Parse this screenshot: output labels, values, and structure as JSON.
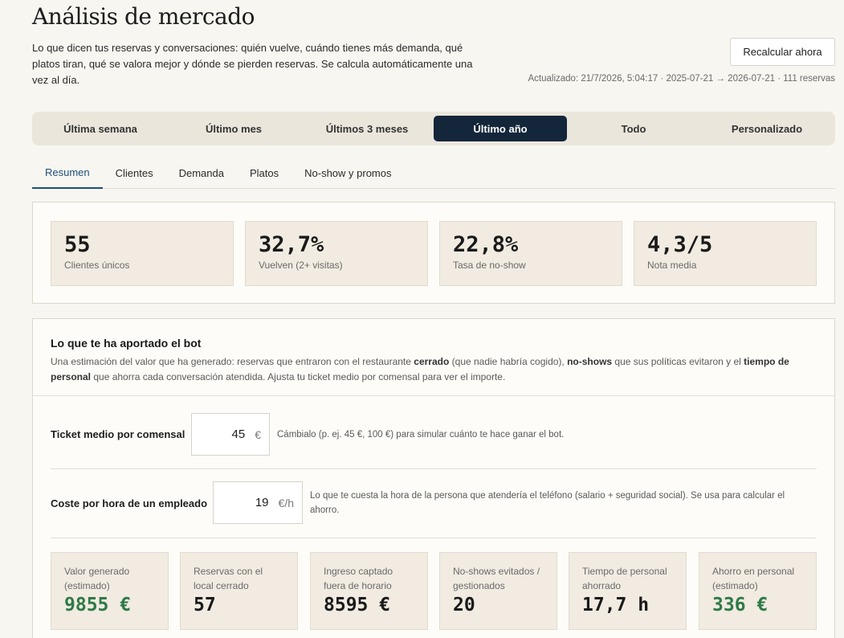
{
  "header": {
    "title": "Análisis de mercado",
    "description": "Lo que dicen tus reservas y conversaciones: quién vuelve, cuándo tienes más demanda, qué platos tiran, qué se valora mejor y dónde se pierden reservas. Se calcula automáticamente una vez al día.",
    "recalc_label": "Recalcular ahora",
    "updated": "Actualizado: 21/7/2026, 5:04:17 · 2025-07-21 → 2026-07-21 · 111 reservas"
  },
  "ranges": [
    "Última semana",
    "Último mes",
    "Últimos 3 meses",
    "Último año",
    "Todo",
    "Personalizado"
  ],
  "active_range": "Último año",
  "tabs": [
    "Resumen",
    "Clientes",
    "Demanda",
    "Platos",
    "No-show y promos"
  ],
  "active_tab": "Resumen",
  "kpis": [
    {
      "value": "55",
      "label": "Clientes únicos"
    },
    {
      "value": "32,7%",
      "label": "Vuelven (2+ visitas)"
    },
    {
      "value": "22,8%",
      "label": "Tasa de no-show"
    },
    {
      "value": "4,3/5",
      "label": "Nota media"
    }
  ],
  "bot": {
    "title": "Lo que te ha aportado el bot",
    "desc_1": "Una estimación del valor que ha generado: reservas que entraron con el restaurante ",
    "desc_b1": "cerrado",
    "desc_2": " (que nadie habría cogido), ",
    "desc_b2": "no-shows",
    "desc_3": " que sus políticas evitaron y el ",
    "desc_b3": "tiempo de personal",
    "desc_4": " que ahorra cada conversación atendida. Ajusta tu ticket medio por comensal para ver el importe.",
    "ticket": {
      "label": "Ticket medio por comensal",
      "value": "45",
      "unit": "€",
      "help": "Cámbialo (p. ej. 45 €, 100 €) para simular cuánto te hace ganar el bot."
    },
    "cost": {
      "label": "Coste por hora de un empleado",
      "value": "19",
      "unit": "€/h",
      "help": "Lo que te cuesta la hora de la persona que atendería el teléfono (salario + seguridad social). Se usa para calcular el ahorro."
    },
    "stats": [
      {
        "label": "Valor generado (estimado)",
        "value": "9855 €",
        "accent": "#2e7a47"
      },
      {
        "label": "Reservas con el local cerrado",
        "value": "57"
      },
      {
        "label": "Ingreso captado fuera de horario",
        "value": "8595 €"
      },
      {
        "label": "No-shows evitados / gestionados",
        "value": "20"
      },
      {
        "label": "Tiempo de personal ahorrado",
        "value": "17,7 h"
      },
      {
        "label": "Ahorro en personal (estimado)",
        "value": "336 €",
        "accent": "#2e7a47"
      }
    ]
  },
  "colors": {
    "active_range_bg": "#14263a",
    "active_tab": "#1d4f7a",
    "positive": "#2e7a47",
    "card_bg": "#f1ebe1"
  }
}
